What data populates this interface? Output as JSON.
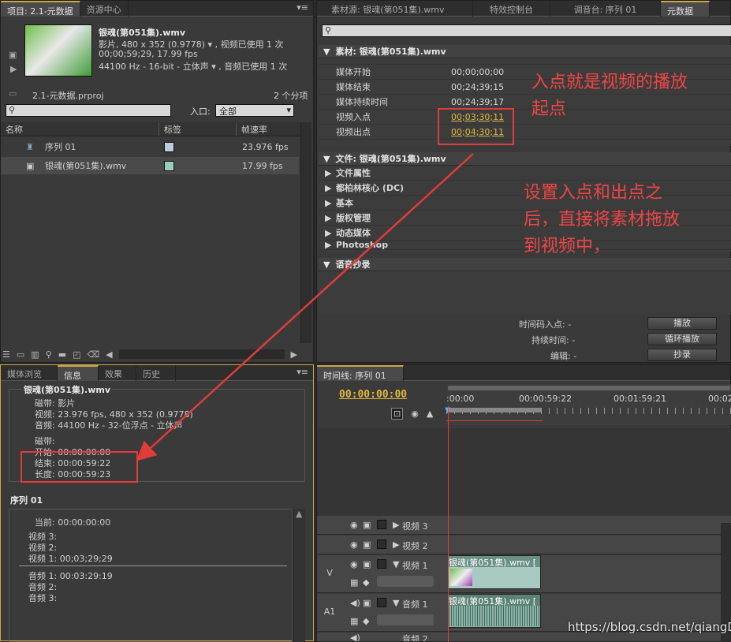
{
  "project": {
    "tabs": [
      "项目: 2.1-元数据",
      "资源中心"
    ],
    "clip_title": "银魂(第051集).wmv",
    "clip_line1": "影片, 480 x 352 (0.9778) ▾ , 视频已使用 1 次",
    "clip_line2": "00;00;59;29, 17.99 fps",
    "clip_line3": "44100 Hz - 16-bit - 立体声 ▾ , 音频已使用 1 次",
    "file": "2.1-元数据.prproj",
    "count": "2 个分项",
    "inpoint_label": "入口:",
    "inpoint_value": "全部",
    "col_name": "名称",
    "col_label": "标签",
    "col_fps": "帧速率",
    "items": [
      {
        "name": "序列 01",
        "fps": "23.976 fps"
      },
      {
        "name": "银魂(第051集).wmv",
        "fps": "17.99 fps"
      }
    ]
  },
  "source": {
    "tabs": [
      "素材源: 银魂(第051集).wmv",
      "特效控制台",
      "调音台: 序列 01",
      "元数据"
    ],
    "section_clip": "素材: 银魂(第051集).wmv",
    "props": [
      {
        "k": "媒体开始",
        "v": "00;00;00;00"
      },
      {
        "k": "媒体结束",
        "v": "00;24;39;15"
      },
      {
        "k": "媒体持续时间",
        "v": "00;24;39;17"
      },
      {
        "k": "视频入点",
        "v": "00;03;30;11"
      },
      {
        "k": "视频出点",
        "v": "00;04;30;11"
      }
    ],
    "section_file": "文件: 银魂(第051集).wmv",
    "groups": [
      "文件属性",
      "都柏林核心 (DC)",
      "基本",
      "版权管理",
      "动态媒体",
      "Photoshop"
    ],
    "speech": "语音抄录",
    "tc_in": "时间码入点: -",
    "duration": "持续时间: -",
    "edit": "编辑: -",
    "btn_play": "播放",
    "btn_loop": "循环播放",
    "btn_transcribe": "抄录"
  },
  "info": {
    "tabs": [
      "媒体浏览",
      "信息",
      "效果",
      "历史"
    ],
    "title": "银魂(第051集).wmv",
    "lines": [
      "磁带: 影片",
      "视频: 23.976 fps, 480 x 352 (0.9778)",
      "音频: 44100 Hz - 32-位浮点 - 立体声",
      "磁带:",
      "开始: 00:00:00:00",
      "结束: 00:00:59:22",
      "长度: 00:00:59:23"
    ],
    "seq_title": "序列 01",
    "current": "当前: 00:00:00:00",
    "vlines": [
      "视频 3:",
      "视频 2:",
      "视频 1: 00;03;29;29"
    ],
    "alines": [
      "音频 1: 00:03:29:19",
      "音频 2:",
      "音频 3:"
    ]
  },
  "timeline": {
    "tab": "时间线: 序列 01",
    "timecode": "00:00:00:00",
    "ruler": [
      ":00:00",
      "00:00:59:22",
      "00:01:59:21",
      "00:02"
    ],
    "tracks": [
      "视频 3",
      "视频 2",
      "视频 1",
      "音频 1",
      "音频 2"
    ],
    "v": "V",
    "a1": "A1",
    "clip_v": "银魂(第051集).wmv [",
    "clip_a": "银魂(第051集).wmv ["
  },
  "notes": {
    "n1": "入点就是视频的播放起点",
    "n1a": "入点就是视频的播放",
    "n1b": "起点",
    "n2a": "设置入点和出点之",
    "n2b": "后，直接将素材拖放",
    "n2c": "到视频中，"
  },
  "watermark": "https://blog.csdn.net/qiangD",
  "colors": {
    "accent": "#c9a64a",
    "annotation": "#e23b3b",
    "timecode": "#e0b83c"
  }
}
